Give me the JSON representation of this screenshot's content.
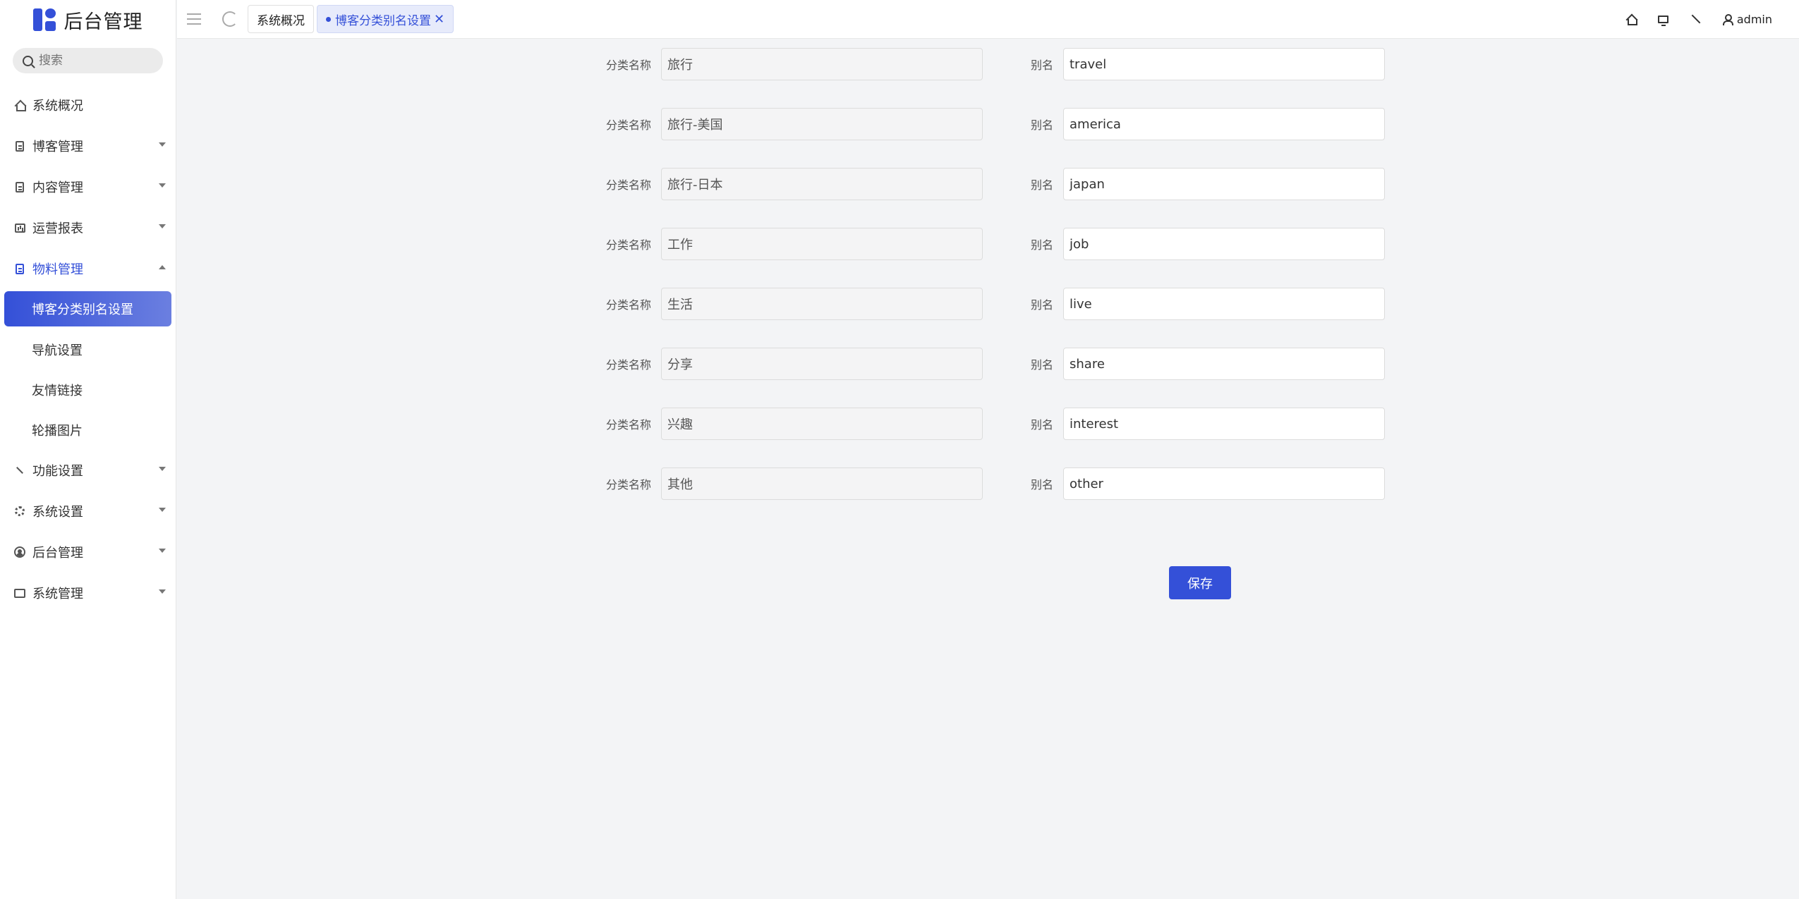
{
  "app": {
    "title": "后台管理"
  },
  "search": {
    "placeholder": "搜索"
  },
  "sidebar": {
    "items": [
      {
        "label": "系统概况",
        "icon": "home-icon",
        "has_arrow": false
      },
      {
        "label": "博客管理",
        "icon": "document-icon",
        "has_arrow": true
      },
      {
        "label": "内容管理",
        "icon": "document-icon",
        "has_arrow": true
      },
      {
        "label": "运营报表",
        "icon": "chart-icon",
        "has_arrow": true
      },
      {
        "label": "物料管理",
        "icon": "document-icon",
        "has_arrow": true,
        "open": true,
        "children": [
          {
            "label": "博客分类别名设置",
            "active": true
          },
          {
            "label": "导航设置"
          },
          {
            "label": "友情链接"
          },
          {
            "label": "轮播图片"
          }
        ]
      },
      {
        "label": "功能设置",
        "icon": "wrench-icon",
        "has_arrow": true
      },
      {
        "label": "系统设置",
        "icon": "gear-icon",
        "has_arrow": true
      },
      {
        "label": "后台管理",
        "icon": "user-circle-icon",
        "has_arrow": true
      },
      {
        "label": "系统管理",
        "icon": "code-icon",
        "has_arrow": true
      }
    ]
  },
  "tabs": [
    {
      "label": "系统概况",
      "active": false
    },
    {
      "label": "博客分类别名设置",
      "active": true,
      "close": "✕"
    }
  ],
  "header": {
    "user": "admin"
  },
  "form": {
    "name_label": "分类名称",
    "alias_label": "别名",
    "rows": [
      {
        "name": "旅行",
        "alias": "travel"
      },
      {
        "name": "旅行-美国",
        "alias": "america"
      },
      {
        "name": "旅行-日本",
        "alias": "japan"
      },
      {
        "name": "工作",
        "alias": "job"
      },
      {
        "name": "生活",
        "alias": "live"
      },
      {
        "name": "分享",
        "alias": "share"
      },
      {
        "name": "兴趣",
        "alias": "interest"
      },
      {
        "name": "其他",
        "alias": "other"
      }
    ],
    "save_label": "保存"
  },
  "colors": {
    "accent": "#3450d8",
    "background": "#f3f4f6",
    "active_tab_bg": "#e7ebfb"
  }
}
